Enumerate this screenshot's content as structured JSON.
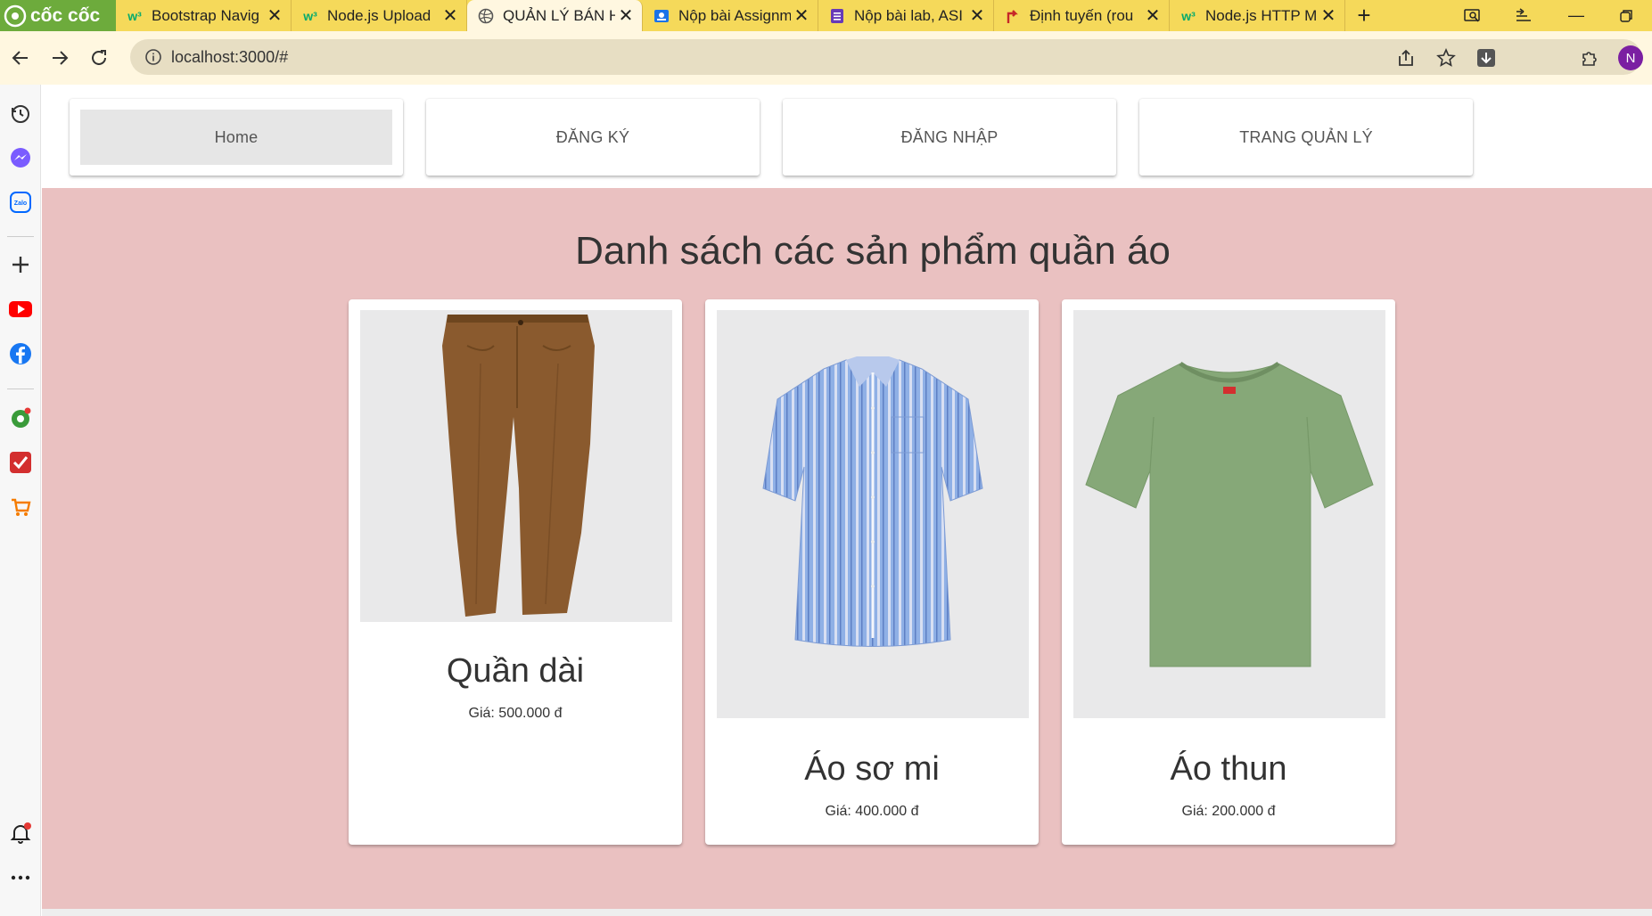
{
  "browser": {
    "brand": "cốc cốc",
    "tabs": [
      {
        "title": "Bootstrap Navig",
        "favicon": "w3schools-icon",
        "color": "#04aa6d"
      },
      {
        "title": "Node.js Upload",
        "favicon": "w3schools-icon",
        "color": "#04aa6d"
      },
      {
        "title": "QUẢN LÝ BÁN H",
        "favicon": "globe-icon",
        "color": "#555555"
      },
      {
        "title": "Nộp bài Assignm",
        "favicon": "classroom-icon",
        "color": "#1a73e8"
      },
      {
        "title": "Nộp bài lab, ASI",
        "favicon": "form-icon",
        "color": "#673ab7"
      },
      {
        "title": "Định tuyến (rou",
        "favicon": "route-icon",
        "color": "#c62828"
      },
      {
        "title": "Node.js HTTP M",
        "favicon": "w3schools-icon",
        "color": "#04aa6d"
      }
    ],
    "url": "localhost:3000/#",
    "avatar_letter": "N"
  },
  "nav": {
    "home": "Home",
    "register": "ĐĂNG KÝ",
    "login": "ĐĂNG NHẬP",
    "admin": "TRANG QUẢN LÝ"
  },
  "page": {
    "heading": "Danh sách các sản phẩm quần áo"
  },
  "products": [
    {
      "name": "Quần dài",
      "price": "Giá: 500.000 đ",
      "image": "brown-pants",
      "color": "#8a5a2e"
    },
    {
      "name": "Áo sơ mi",
      "price": "Giá: 400.000 đ",
      "image": "blue-striped-shirt",
      "color": "#8fb0e6"
    },
    {
      "name": "Áo thun",
      "price": "Giá: 200.000 đ",
      "image": "green-tshirt",
      "color": "#86a878"
    }
  ],
  "colors": {
    "tabbar": "#f5d95a",
    "brand": "#6dab3c",
    "page_bg": "#eac1c1"
  }
}
